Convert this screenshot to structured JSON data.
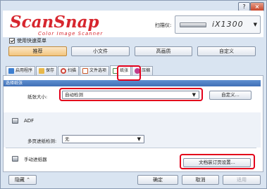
{
  "window": {
    "help_label": "?",
    "close_label": "×"
  },
  "header": {
    "logo_main": "ScanSnap",
    "logo_sub": "Color Image Scanner",
    "scanner_label": "扫描仪:",
    "scanner_model": "iX1300",
    "scanner_icon": "scanner-device-icon"
  },
  "quick_menu": {
    "label": "使用快速菜单",
    "checked": true
  },
  "profiles": [
    {
      "label": "推荐",
      "selected": true
    },
    {
      "label": "小文件",
      "selected": false
    },
    {
      "label": "高画质",
      "selected": false
    },
    {
      "label": "自定义",
      "selected": false
    }
  ],
  "tabs": [
    {
      "label": "启用程序",
      "icon": "application-icon",
      "color": "#3d7fd0"
    },
    {
      "label": "保存",
      "icon": "folder-icon",
      "color": "#e8b84a"
    },
    {
      "label": "扫描",
      "icon": "scan-icon",
      "color": "#d0473a"
    },
    {
      "label": "文件选项",
      "icon": "file-icon",
      "color": "#cc5a2a"
    },
    {
      "label": "纸张",
      "icon": "paper-icon",
      "color": "#4a8a4a",
      "active": true
    },
    {
      "label": "压缩",
      "icon": "compress-icon",
      "color": "#c33b8a"
    }
  ],
  "paper": {
    "section_title": "选择纸张",
    "size_label": "纸张大小:",
    "size_value": "自动检测",
    "custom_button": "自定义...",
    "adf_label": "ADF",
    "multifeed_label": "多页进纸检测:",
    "multifeed_value": "无",
    "manual_label": "手动进纸器",
    "manual_button": "文档装订页设置..."
  },
  "footer": {
    "hide_label": "隐藏",
    "ok_label": "确定",
    "cancel_label": "取消",
    "apply_label": "适用"
  },
  "colors": {
    "brand": "#d7262e",
    "highlight": "#e3001b",
    "section_bar": "#4a7cc2"
  }
}
